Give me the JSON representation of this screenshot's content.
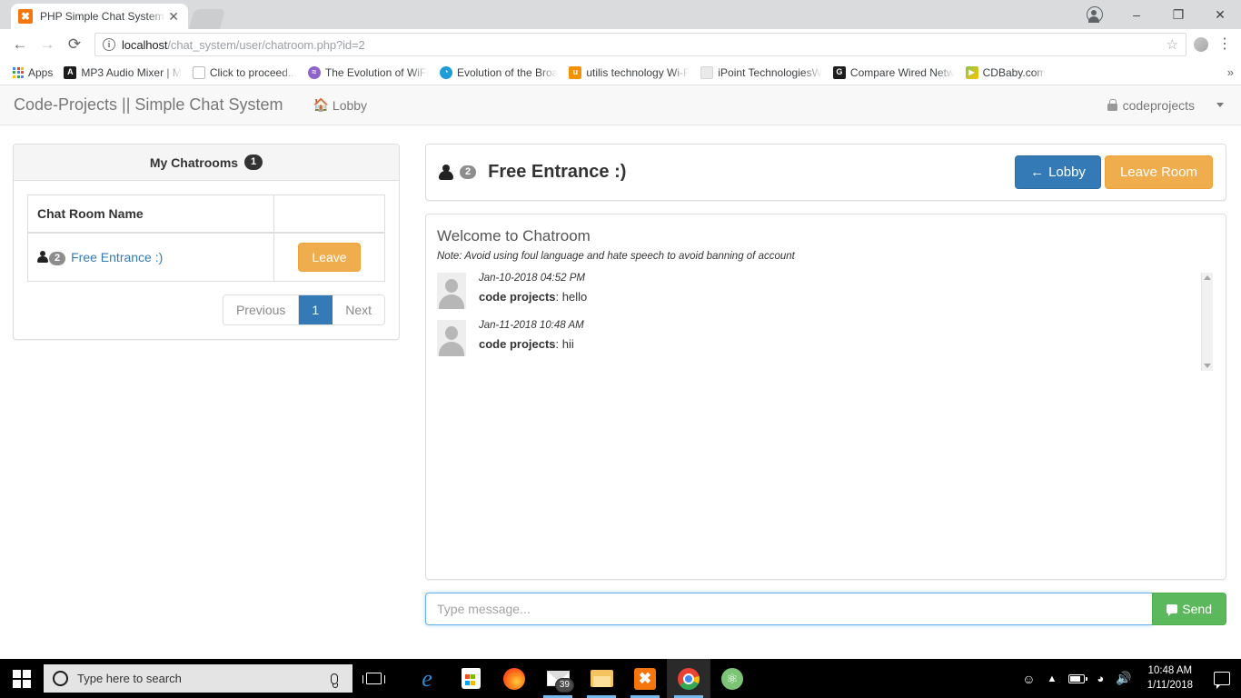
{
  "browser": {
    "tab": {
      "title": "PHP Simple Chat System",
      "favicon": "xampp-icon",
      "close": "✕"
    },
    "url_prefix": "localhost",
    "url_suffix": "/chat_system/user/chatroom.php?id=2",
    "nav": {
      "back": "←",
      "forward": "→",
      "reload": "⟳",
      "star": "☆",
      "menu": "⋮"
    },
    "window": {
      "minimize": "–",
      "maximize": "❐",
      "close": "✕"
    },
    "bookmarks": {
      "apps_label": "Apps",
      "items": [
        {
          "label": "MP3 Audio Mixer | M",
          "icon": "a-icon",
          "color": "#1c1c1c",
          "glyph": "A"
        },
        {
          "label": "Click to proceed...",
          "icon": "page-icon",
          "color": "#ffffff",
          "glyph": ""
        },
        {
          "label": "The Evolution of WiFi",
          "icon": "wifi-icon",
          "color": "#8e64c8",
          "glyph": ""
        },
        {
          "label": "Evolution of the Broa",
          "icon": "globe-icon",
          "color": "#1f9bd8",
          "glyph": ""
        },
        {
          "label": "utilis technology Wi-F",
          "icon": "u-icon",
          "color": "#f39200",
          "glyph": "u"
        },
        {
          "label": "iPoint TechnologiesW",
          "icon": "blank-icon",
          "color": "#e8e8e8",
          "glyph": ""
        },
        {
          "label": "Compare Wired Netw",
          "icon": "google-icon",
          "color": "#1c1c1c",
          "glyph": "G"
        },
        {
          "label": "CDBaby.com",
          "icon": "cdbaby-icon",
          "color": "#4caf50",
          "glyph": "▶"
        }
      ],
      "overflow": "»"
    }
  },
  "navbar": {
    "brand": "Code-Projects || Simple Chat System",
    "lobby_link": "Lobby",
    "lobby_icon": "home-icon",
    "user": "codeprojects",
    "user_icon": "lock-icon",
    "caret_icon": "chevron-down-icon"
  },
  "sidebar": {
    "heading": "My Chatrooms",
    "count": "1",
    "table": {
      "columns": [
        "Chat Room Name",
        ""
      ],
      "rows": [
        {
          "members": "2",
          "name": "Free Entrance :)",
          "action": "Leave"
        }
      ]
    },
    "pagination": {
      "previous": "Previous",
      "pages": [
        "1"
      ],
      "next": "Next",
      "active": "1"
    }
  },
  "chat": {
    "members": "2",
    "title": "Free Entrance :)",
    "lobby_button": "Lobby",
    "lobby_icon": "arrow-left-icon",
    "leave_button": "Leave Room",
    "welcome": "Welcome to Chatroom",
    "note": "Note: Avoid using foul language and hate speech to avoid banning of account",
    "messages": [
      {
        "time": "Jan-10-2018 04:52 PM",
        "author": "code projects",
        "text": "hello"
      },
      {
        "time": "Jan-11-2018 10:48 AM",
        "author": "code projects",
        "text": "hii"
      }
    ],
    "input_placeholder": "Type message...",
    "input_value": "",
    "send_button": "Send",
    "send_icon": "chat-bubble-icon"
  },
  "colors": {
    "primary": "#337ab7",
    "warning": "#f0ad4e",
    "success": "#5cb85c",
    "link": "#337ab7",
    "badge_dark": "#333333",
    "badge_gray": "#8d8d8d"
  },
  "taskbar": {
    "start_icon": "windows-logo-icon",
    "search_placeholder": "Type here to search",
    "search_icon": "cortana-circle-icon",
    "mic_icon": "microphone-icon",
    "taskview_icon": "task-view-icon",
    "apps": [
      {
        "name": "edge-icon",
        "glyph": "e",
        "color": "#1f8bd8",
        "badge": "",
        "state": ""
      },
      {
        "name": "store-icon",
        "glyph": "",
        "color": "#ffffff",
        "badge": "",
        "state": ""
      },
      {
        "name": "firefox-icon",
        "glyph": "",
        "color": "#ff7139",
        "badge": "",
        "state": ""
      },
      {
        "name": "mail-icon",
        "glyph": "",
        "color": "#ffffff",
        "badge": "39",
        "state": "open"
      },
      {
        "name": "file-explorer-icon",
        "glyph": "",
        "color": "#f5c463",
        "badge": "",
        "state": "open"
      },
      {
        "name": "xampp-icon",
        "glyph": "✖",
        "color": "#f4760c",
        "badge": "",
        "state": "open"
      },
      {
        "name": "chrome-icon",
        "glyph": "",
        "color": "#4caf50",
        "badge": "",
        "state": "active"
      },
      {
        "name": "atom-icon",
        "glyph": "⚛",
        "color": "#7cc576",
        "badge": "",
        "state": ""
      }
    ],
    "tray": {
      "people_icon": "people-icon",
      "chevron_icon": "chevron-up-icon",
      "battery_icon": "battery-icon",
      "network_icon": "wifi-icon",
      "volume_icon": "volume-icon",
      "time": "10:48 AM",
      "date": "1/11/2018",
      "action_center_icon": "action-center-icon"
    }
  }
}
